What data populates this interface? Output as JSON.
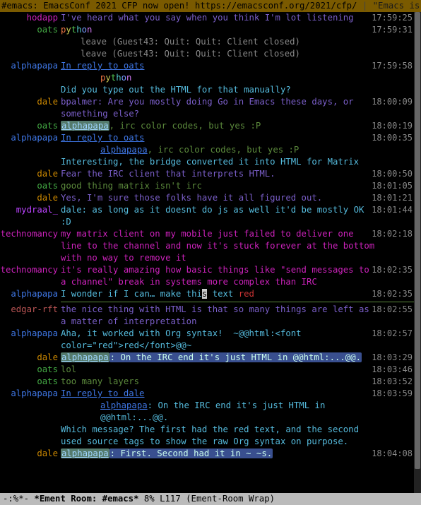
{
  "header": {
    "channel": "#emacs",
    "topic_a": ": EmacsConf 2021 CFP now open! https://emacsconf.org/2021/cfp/ ",
    "sep": "|",
    "topic_b": " \"Emacs is a co"
  },
  "nick_colors": {
    "hodapp": "#c2b",
    "oats": "#4a4",
    "alphapapa": "#3f77e6",
    "dale": "#c80",
    "mydraal_": "#b4f",
    "technomancy": "#c2b",
    "edgar-rft": "#b55"
  },
  "messages": [
    {
      "nick": "hodapp",
      "color": "#c2b",
      "ts": "17:59:25",
      "segs": [
        {
          "t": "plain",
          "c": "#7b5fca",
          "v": "I've heard what you say when you think I'm lot listening"
        }
      ]
    },
    {
      "nick": "oats",
      "color": "#4a4",
      "ts": "17:59:31",
      "segs": [
        {
          "t": "rainbow",
          "v": "python"
        }
      ]
    },
    {
      "nick": "",
      "ts": "",
      "segs": [
        {
          "t": "plain",
          "c": "#888",
          "v": "leave (Guest43: Quit: Quit: Client closed)"
        }
      ],
      "indent": 1
    },
    {
      "nick": "",
      "ts": "",
      "segs": [
        {
          "t": "plain",
          "c": "#888",
          "v": "leave (Guest43: Quit: Quit: Client closed)"
        }
      ],
      "indent": 1
    },
    {
      "nick": "alphapapa",
      "color": "#3f77e6",
      "ts": "17:59:58",
      "segs": [
        {
          "t": "link",
          "v": "In reply to "
        },
        {
          "t": "link",
          "v": "oats"
        }
      ]
    },
    {
      "nick": "",
      "ts": "",
      "segs": [
        {
          "t": "rainbow",
          "v": "python"
        }
      ],
      "indent": 2
    },
    {
      "nick": "",
      "ts": "",
      "segs": [
        {
          "t": "plain",
          "c": "#5bd",
          "v": ""
        }
      ]
    },
    {
      "nick": "",
      "ts": "",
      "segs": [
        {
          "t": "plain",
          "c": "#5bd",
          "v": "Did you type out the HTML for that manually?"
        }
      ]
    },
    {
      "nick": "dale",
      "color": "#c80",
      "ts": "18:00:09",
      "segs": [
        {
          "t": "plain",
          "c": "#7b5fca",
          "v": "bpalmer: Are you mostly doing Go in Emacs these days, or something else?"
        }
      ]
    },
    {
      "nick": "oats",
      "color": "#4a4",
      "ts": "18:00:19",
      "segs": [
        {
          "t": "hlnick",
          "v": "alphapapa"
        },
        {
          "t": "plain",
          "c": "#5c8a3c",
          "v": ", irc color codes, but yes :P"
        }
      ]
    },
    {
      "nick": "alphapapa",
      "color": "#3f77e6",
      "ts": "18:00:35",
      "segs": [
        {
          "t": "link",
          "v": "In reply to "
        },
        {
          "t": "link",
          "v": "oats"
        }
      ]
    },
    {
      "nick": "",
      "ts": "",
      "segs": [
        {
          "t": "link",
          "v": "alphapapa"
        },
        {
          "t": "plain",
          "c": "#5c8a3c",
          "v": ", irc color codes, but yes :P"
        }
      ],
      "indent": 2
    },
    {
      "nick": "",
      "ts": "",
      "segs": [
        {
          "t": "plain",
          "c": "#5bd",
          "v": ""
        }
      ]
    },
    {
      "nick": "",
      "ts": "",
      "segs": [
        {
          "t": "plain",
          "c": "#5bd",
          "v": "Interesting, the bridge converted it into HTML for Matrix"
        }
      ]
    },
    {
      "nick": "dale",
      "color": "#c80",
      "ts": "18:00:50",
      "segs": [
        {
          "t": "plain",
          "c": "#7b5fca",
          "v": "Fear the IRC client that interprets HTML."
        }
      ]
    },
    {
      "nick": "oats",
      "color": "#4a4",
      "ts": "18:01:05",
      "segs": [
        {
          "t": "plain",
          "c": "#5c8a3c",
          "v": "good thing matrix isn't irc"
        }
      ]
    },
    {
      "nick": "dale",
      "color": "#c80",
      "ts": "18:01:21",
      "segs": [
        {
          "t": "plain",
          "c": "#7b5fca",
          "v": "Yes, I'm sure those folks have it all figured out."
        }
      ]
    },
    {
      "nick": "mydraal_",
      "color": "#b4f",
      "ts": "18:01:44",
      "segs": [
        {
          "t": "plain",
          "c": "#5bd",
          "v": "dale: as long as it doesnt do js as well it'd be mostly OK :D"
        }
      ]
    },
    {
      "nick": "technomancy",
      "color": "#c2b",
      "ts": "18:02:18",
      "segs": [
        {
          "t": "plain",
          "c": "#c2b",
          "v": "my matrix client on my mobile just failed to deliver one line to the channel and now it's stuck forever at the bottom with no way to remove it"
        }
      ]
    },
    {
      "nick": "technomancy",
      "color": "#c2b",
      "ts": "18:02:35",
      "segs": [
        {
          "t": "plain",
          "c": "#c2b",
          "v": "it's really amazing how basic things like \"send messages to a channel\" break in systems more complex than IRC"
        }
      ]
    },
    {
      "nick": "alphapapa",
      "color": "#3f77e6",
      "ts": "18:02:35",
      "segs": [
        {
          "t": "plain",
          "c": "#5bd",
          "v": "I wonder if I can… make thi"
        },
        {
          "t": "cursor",
          "v": "s"
        },
        {
          "t": "plain",
          "c": "#5bd",
          "v": " text "
        },
        {
          "t": "plain",
          "c": "#c33",
          "v": "red"
        }
      ],
      "hr_after": true
    },
    {
      "nick": "edgar-rft",
      "color": "#b55",
      "ts": "18:02:55",
      "segs": [
        {
          "t": "plain",
          "c": "#7b5fca",
          "v": "the nice thing with HTML is that so many things are left as a matter of interpretation"
        }
      ]
    },
    {
      "nick": "alphapapa",
      "color": "#3f77e6",
      "ts": "18:02:57",
      "segs": [
        {
          "t": "plain",
          "c": "#5bd",
          "v": "Aha, it worked with Org syntax!  ~"
        },
        {
          "t": "plain",
          "c": "#5bd",
          "v": "@@html:<font color=\"red\">red</font>@@"
        },
        {
          "t": "plain",
          "c": "#5bd",
          "v": "~"
        }
      ]
    },
    {
      "nick": "dale",
      "color": "#c80",
      "ts": "18:03:29",
      "segs": [
        {
          "t": "hlnick",
          "v": "alphapapa"
        },
        {
          "t": "hlmsg",
          "v": ": On the IRC end it's just HTML in @@html:...@@."
        }
      ]
    },
    {
      "nick": "oats",
      "color": "#4a4",
      "ts": "18:03:46",
      "segs": [
        {
          "t": "plain",
          "c": "#5c8a3c",
          "v": "lol"
        }
      ]
    },
    {
      "nick": "oats",
      "color": "#4a4",
      "ts": "18:03:52",
      "segs": [
        {
          "t": "plain",
          "c": "#5c8a3c",
          "v": "too many layers"
        }
      ]
    },
    {
      "nick": "alphapapa",
      "color": "#3f77e6",
      "ts": "18:03:59",
      "segs": [
        {
          "t": "link",
          "v": "In reply to "
        },
        {
          "t": "link",
          "v": "dale"
        }
      ]
    },
    {
      "nick": "",
      "ts": "",
      "segs": [
        {
          "t": "link",
          "v": "alphapapa"
        },
        {
          "t": "plain",
          "c": "#5bd",
          "v": ": On the IRC end it's just HTML in @@html:...@@."
        }
      ],
      "indent": 2
    },
    {
      "nick": "",
      "ts": "",
      "segs": [
        {
          "t": "plain",
          "c": "#5bd",
          "v": ""
        }
      ]
    },
    {
      "nick": "",
      "ts": "",
      "segs": [
        {
          "t": "plain",
          "c": "#5bd",
          "v": "Which message? The first had the red text, and the second used source tags to show the raw Org syntax on purpose."
        }
      ]
    },
    {
      "nick": "dale",
      "color": "#c80",
      "ts": "18:04:08",
      "segs": [
        {
          "t": "hlnick",
          "v": "alphapapa"
        },
        {
          "t": "hlmsg",
          "v": ": First. Second had it in ~ ~s."
        }
      ]
    }
  ],
  "modeline": {
    "left": "-:%*-  ",
    "buffer": "*Ement Room: #emacs*",
    "mid": "   8% L117   ",
    "mode": "(Ement-Room Wrap)"
  }
}
